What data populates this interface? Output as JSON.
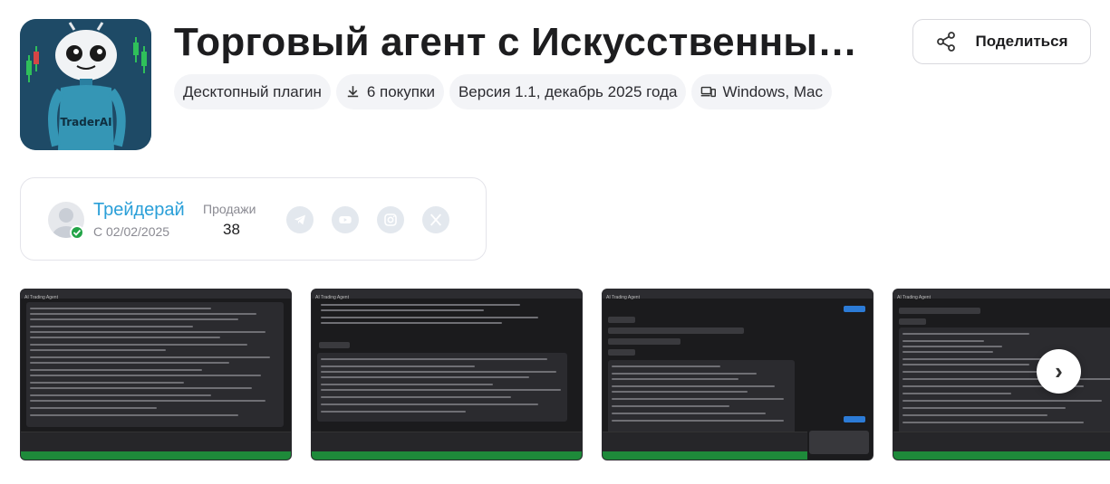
{
  "product": {
    "title": "Торговый агент с Искусственны…",
    "logo_text": "TraderAI"
  },
  "share": {
    "label": "Поделиться",
    "icon": "share-icon"
  },
  "meta_chips": [
    {
      "label": "Десктопный плагин",
      "icon": ""
    },
    {
      "label": "6 покупки",
      "icon": "download-icon"
    },
    {
      "label": "Версия 1.1, декабрь 2025 года",
      "icon": ""
    },
    {
      "label": "Windows, Mac",
      "icon": "devices-icon"
    }
  ],
  "seller": {
    "name": "Трейдерай",
    "since": "С 02/02/2025",
    "sales_label": "Продажи",
    "sales_value": "38",
    "socials": [
      "telegram-icon",
      "youtube-icon",
      "instagram-icon",
      "x-icon"
    ]
  },
  "gallery": {
    "screenshots": [
      {
        "caption": "AI Trading Agent"
      },
      {
        "caption": "AI Trading Agent"
      },
      {
        "caption": "AI Trading Agent"
      },
      {
        "caption": "AI Trading Agent"
      }
    ],
    "next_label": "›"
  },
  "colors": {
    "accent": "#2a9fd8",
    "verified": "#22a447",
    "chip_bg": "#f3f4f7",
    "screenshot_bg": "#1b1b1d",
    "screenshot_send": "#1e8a3a"
  }
}
